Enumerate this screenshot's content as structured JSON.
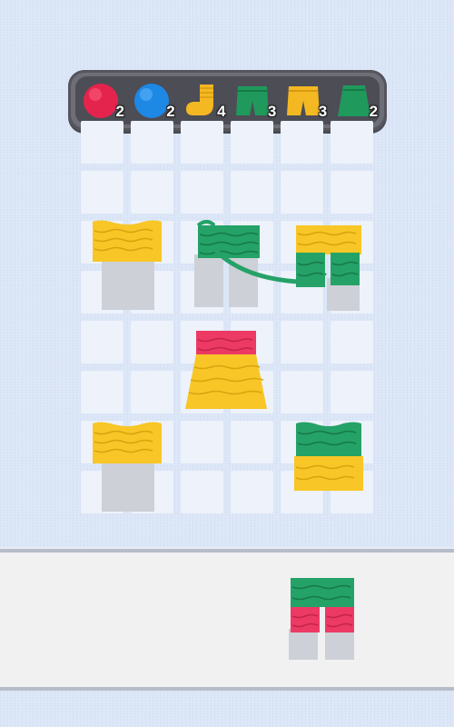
{
  "goals": [
    {
      "name": "red-yarn-ball-goal",
      "icon": "red-yarn-ball-icon",
      "color": "#e5244e",
      "count": "2"
    },
    {
      "name": "blue-yarn-ball-goal",
      "icon": "blue-yarn-ball-icon",
      "color": "#1e88e5",
      "count": "2"
    },
    {
      "name": "yellow-sock-goal",
      "icon": "yellow-sock-icon",
      "color": "#f4b822",
      "count": "4"
    },
    {
      "name": "green-shorts-goal",
      "icon": "green-shorts-icon",
      "color": "#1f9a5c",
      "count": "3"
    },
    {
      "name": "yellow-shorts-goal",
      "icon": "yellow-shorts-icon",
      "color": "#f4b822",
      "count": "3"
    },
    {
      "name": "green-skirt-goal",
      "icon": "green-skirt-icon",
      "color": "#1f9a5c",
      "count": "2"
    }
  ],
  "colors": {
    "yarn_red": "#ec3a64",
    "yarn_yellow": "#f8c626",
    "yarn_green": "#25a267",
    "gray_base": "#c9ccd2",
    "board_cell": "#edf2fb",
    "background": "#dbe6f7"
  },
  "board_pieces": [
    "yellow-sweater",
    "green-shorts-unraveling",
    "yellow-green-shorts",
    "red-yellow-skirt",
    "yellow-sweater",
    "green-yellow-sweater"
  ],
  "tray_piece": "green-red-shorts"
}
